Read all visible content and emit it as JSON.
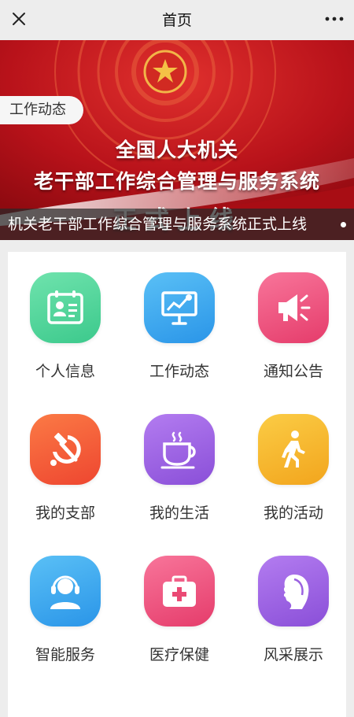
{
  "header": {
    "title": "首页"
  },
  "banner": {
    "tag": "工作动态",
    "line1": "全国人大机关",
    "line2": "老干部工作综合管理与服务系统",
    "line3": "正式上线",
    "caption": "机关老干部工作综合管理与服务系统正式上线"
  },
  "grid": [
    {
      "label": "个人信息",
      "icon": "id-card-icon",
      "color": "#4fd49c"
    },
    {
      "label": "工作动态",
      "icon": "presentation-chart-icon",
      "color": "#2fa8ee"
    },
    {
      "label": "通知公告",
      "icon": "megaphone-icon",
      "color": "#f04f7a"
    },
    {
      "label": "我的支部",
      "icon": "hammer-sickle-icon",
      "color": "#f55a3c"
    },
    {
      "label": "我的生活",
      "icon": "coffee-cup-icon",
      "color": "#9b62e0"
    },
    {
      "label": "我的活动",
      "icon": "walking-person-icon",
      "color": "#f5b82a"
    },
    {
      "label": "智能服务",
      "icon": "customer-service-icon",
      "color": "#2fa8ee"
    },
    {
      "label": "医疗保健",
      "icon": "medical-kit-icon",
      "color": "#f04f7a"
    },
    {
      "label": "风采展示",
      "icon": "woman-profile-icon",
      "color": "#9b62e0"
    }
  ]
}
